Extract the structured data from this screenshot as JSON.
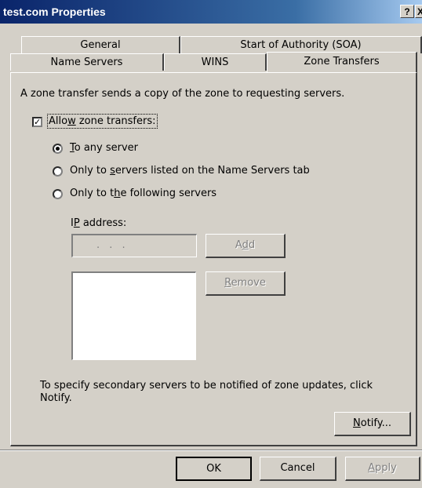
{
  "window": {
    "title": "test.com Properties",
    "help_label": "?",
    "close_label": "X"
  },
  "tabs": {
    "row1": [
      {
        "label": "General"
      },
      {
        "label": "Start of Authority (SOA)"
      }
    ],
    "row2": [
      {
        "label": "Name Servers"
      },
      {
        "label": "WINS"
      },
      {
        "label": "Zone Transfers",
        "active": true
      }
    ]
  },
  "zone_transfers": {
    "description": "A zone transfer sends a copy of the zone to requesting servers.",
    "allow_checkbox": {
      "pre": "Allo",
      "key": "w",
      "post": " zone transfers:",
      "checked": true
    },
    "radios": [
      {
        "pre": "",
        "key": "T",
        "post": "o any server",
        "selected": true
      },
      {
        "pre": "Only to ",
        "key": "s",
        "post": "ervers listed on the Name Servers tab",
        "selected": false
      },
      {
        "pre": "Only to t",
        "key": "h",
        "post": "e following servers",
        "selected": false
      }
    ],
    "ip_label": {
      "pre": "I",
      "key": "P",
      "post": " address:"
    },
    "ip_value": ".   .   .",
    "add_button": {
      "pre": "A",
      "key": "d",
      "post": "d"
    },
    "remove_button": {
      "pre": "",
      "key": "R",
      "post": "emove"
    },
    "notify_text": "To specify secondary servers to be notified of zone updates, click Notify.",
    "notify_button": {
      "pre": "",
      "key": "N",
      "post": "otify..."
    }
  },
  "footer": {
    "ok_label": "OK",
    "cancel_label": "Cancel",
    "apply_button": {
      "pre": "",
      "key": "A",
      "post": "pply"
    }
  }
}
